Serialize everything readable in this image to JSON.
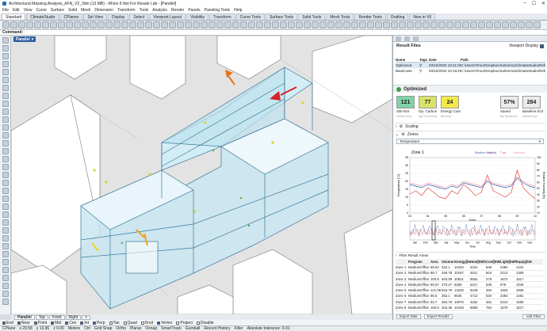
{
  "window": {
    "title": "Architectural Massing Analysis_AFN_V2_3dm (13 MB) - Rhino 6 Not For Resale Lab - [Parallel]",
    "controls": [
      "–",
      "☐",
      "✕"
    ]
  },
  "menu": [
    "File",
    "Edit",
    "View",
    "Curve",
    "Surface",
    "Solid",
    "Mesh",
    "Dimension",
    "Transform",
    "Tools",
    "Analysis",
    "Render",
    "Panels",
    "Paneling Tools",
    "Help"
  ],
  "toolbar_tabs": [
    "Standard",
    "ClimateStudio",
    "CPlanes",
    "Set View",
    "Display",
    "Select",
    "Viewport Layout",
    "Visibility",
    "Transform",
    "Curve Tools",
    "Surface Tools",
    "Solid Tools",
    "Mesh Tools",
    "Render Tools",
    "Drafting",
    "New in V6"
  ],
  "command": {
    "label": "Command:"
  },
  "viewport": {
    "label": "Parallel",
    "dropdown": "▾"
  },
  "view_tabs": [
    "Parallel",
    "Top",
    "Front",
    "Right",
    "+"
  ],
  "osnaps": [
    {
      "label": "End",
      "checked": true
    },
    {
      "label": "Near",
      "checked": true
    },
    {
      "label": "Point",
      "checked": true
    },
    {
      "label": "Mid",
      "checked": true
    },
    {
      "label": "Cen",
      "checked": true
    },
    {
      "label": "Int",
      "checked": true
    },
    {
      "label": "Perp",
      "checked": true
    },
    {
      "label": "Tan",
      "checked": false
    },
    {
      "label": "Quad",
      "checked": false
    },
    {
      "label": "Knot",
      "checked": false
    },
    {
      "label": "Vertex",
      "checked": true
    },
    {
      "label": "Project",
      "checked": false
    },
    {
      "label": "Disable",
      "checked": false
    }
  ],
  "status": {
    "cplane": "CPlane",
    "x": "x 20.58",
    "y": "y 13.96",
    "z": "z 0.00",
    "units": "Meters",
    "layer": "Ctrl",
    "items": [
      "Grid Snap",
      "Ortho",
      "Planar",
      "Osnap",
      "SmartTrack",
      "Gumball",
      "Record History",
      "Filter",
      "Absolute tolerance: 0.01"
    ]
  },
  "panel": {
    "result_files_title": "Result Files",
    "viewport_display": "Viewport Display",
    "columns": [
      "Name",
      "Tags",
      "Date",
      "Path"
    ],
    "rows": [
      {
        "name": "Optimized",
        "tags": "",
        "date": "03/10/2020 10:21:06",
        "path": "C:\\Users\\Timur\\Dropbox\\Solemma\\ClimateStudio\\Reference Models\\Architect"
      },
      {
        "name": "BaseCase",
        "tags": "",
        "date": "03/10/2020 10:19:26",
        "path": "C:\\Users\\Timur\\Dropbox\\Solemma\\ClimateStudio\\Reference Models\\Architect"
      }
    ],
    "optimized_title": "Optimized",
    "metrics": [
      {
        "value": "121",
        "label": "Site EUI",
        "sub": "kWh/m2/yr",
        "color": "#7fd3a8"
      },
      {
        "value": "77",
        "label": "Op. Carbon",
        "sub": "kgCO2/m2/yr",
        "color": "#d9e36b"
      },
      {
        "value": "24",
        "label": "Energy Cost",
        "sub": "$/m2/yr",
        "color": "#f4e94a"
      },
      {
        "value": "57%",
        "label": "Saved",
        "sub": "By Students",
        "color": "#ececec"
      },
      {
        "value": "284",
        "label": "Baseline EUI",
        "sub": "kWh/m2/yr",
        "color": "#ececec"
      }
    ],
    "sections": [
      "Scaling",
      "Zones"
    ],
    "temperature_select": "Temperature",
    "filter_header": "Filter Result Areas",
    "buttons": [
      "Export Data",
      "Export Results",
      "Add Other"
    ]
  },
  "chart_data": {
    "type": "line",
    "title": "Zone 1",
    "legend": [
      "Relative Humidity",
      "Tdb",
      "T air",
      "Operative"
    ],
    "xlabel": "Days",
    "ylabel": "Temperature [°C]",
    "ylabel_right": "Relative Humidity [%]",
    "x_ticks": [
      "03",
      "04",
      "05",
      "06",
      "07",
      "08",
      "09",
      "10"
    ],
    "y_ticks": [
      "35",
      "30",
      "25",
      "20",
      "15",
      "10",
      "5",
      "0"
    ],
    "y_right_ticks": [
      "100",
      "90",
      "80",
      "70",
      "60",
      "50",
      "40",
      "30",
      "20",
      "10"
    ],
    "ylim": [
      0,
      35
    ],
    "series": [
      {
        "name": "Tdb",
        "color": "#e0443c",
        "values": [
          12,
          14,
          11,
          16,
          13,
          10,
          9,
          14,
          12,
          18,
          15,
          11,
          13,
          24,
          14,
          12,
          10,
          13,
          27,
          16,
          12,
          9
        ]
      },
      {
        "name": "T air",
        "color": "#2f5fb3",
        "values": [
          18,
          17,
          16,
          18,
          17,
          16,
          15,
          17,
          16,
          19,
          18,
          17,
          16,
          20,
          18,
          17,
          16,
          17,
          22,
          19,
          17,
          16
        ]
      },
      {
        "name": "Operative",
        "color": "#f39aa0",
        "values": [
          19,
          18,
          17,
          19,
          18,
          17,
          16,
          18,
          17,
          20,
          19,
          18,
          17,
          21,
          19,
          18,
          17,
          18,
          23,
          20,
          18,
          17
        ]
      }
    ],
    "annual_x_ticks": [
      "Jan",
      "Feb",
      "Mar",
      "Apr",
      "May",
      "Jun",
      "Jul",
      "Aug",
      "Sep",
      "Oct",
      "Nov",
      "Dec"
    ],
    "annual_xlabel": "Time"
  },
  "zones_table": {
    "columns": [
      "",
      "Program",
      "Area",
      "Volume",
      "Energy[kWh]",
      "Heat[kWh]",
      "Cool[kWh]",
      "Light[kWh]",
      "Equip[kWh]"
    ],
    "rows": [
      [
        "Zone 1",
        "MediumOffice",
        "85.52",
        "342.1",
        "10184",
        "5341",
        "849",
        "2384",
        "1441"
      ],
      [
        "Zone 2",
        "MediumOffice",
        "85.7",
        "346.78",
        "10167",
        "4611",
        "504",
        "2212",
        "1308"
      ],
      [
        "Zone 3",
        "MediumOffice",
        "100.8",
        "402.09",
        "10621",
        "8562",
        "279",
        "1674",
        "1517"
      ],
      [
        "Zone 4",
        "MediumOffice",
        "80.57",
        "270.27",
        "8208",
        "5417",
        "530",
        "978",
        "1049"
      ],
      [
        "Zone 5",
        "MediumOffice",
        "121.06",
        "515.78",
        "13230",
        "8248",
        "484",
        "1825",
        "1828"
      ],
      [
        "Zone 6",
        "MediumOffice",
        "86.5",
        "362.1",
        "8545",
        "4712",
        "520",
        "2364",
        "1461"
      ],
      [
        "Zone 7",
        "MediumOffice",
        "94.7",
        "384.78",
        "10070",
        "4252",
        "481",
        "2210",
        "1509"
      ],
      [
        "Zone 8",
        "MediumOffice",
        "100.8",
        "402.38",
        "10183",
        "5808",
        "754",
        "1675",
        "1517"
      ]
    ]
  }
}
